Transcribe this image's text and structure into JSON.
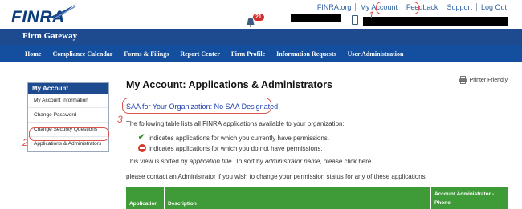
{
  "header": {
    "logo_text": "FINRA",
    "util_links": [
      "FINRA.org",
      "My Account",
      "Feedback",
      "Support",
      "Log Out"
    ],
    "notification_count": "21",
    "banner_title": "Firm Gateway"
  },
  "nav": {
    "items": [
      "Home",
      "Compliance Calendar",
      "Forms & Filings",
      "Report Center",
      "Firm Profile",
      "Information Requests",
      "User Administration"
    ]
  },
  "sidebar": {
    "title": "My Account",
    "items": [
      "My Account Information",
      "Change Password",
      "Change Security Questions",
      "Applications & Administrators"
    ]
  },
  "main": {
    "title": "My Account: Applications & Administrators",
    "printer_friendly": "Printer Friendly",
    "saa_text": "SAA for Your Organization: No SAA Designated",
    "description": "The following table lists all FINRA applications available to your organization:",
    "legend_have": "indicates applications for which you currently have permissions.",
    "legend_not": "indicates applications for which you do not have permissions.",
    "sort_prefix": "This view is sorted by ",
    "sort_title": "application title",
    "sort_mid": ". To sort by ",
    "sort_admin": "administrator name",
    "sort_suffix": ", please click here.",
    "contact": "please contact an Administrator if you wish to change your permission status for any of these applications."
  },
  "table": {
    "headers": [
      "Application",
      "Description",
      "Account Administrator - Phone"
    ]
  },
  "annotations": [
    "1",
    "2",
    "3"
  ],
  "colors": {
    "brand_blue": "#1e4b8f",
    "nav_blue": "#134f9e",
    "table_green": "#3f9a38",
    "highlight_red": "#d9534f"
  }
}
